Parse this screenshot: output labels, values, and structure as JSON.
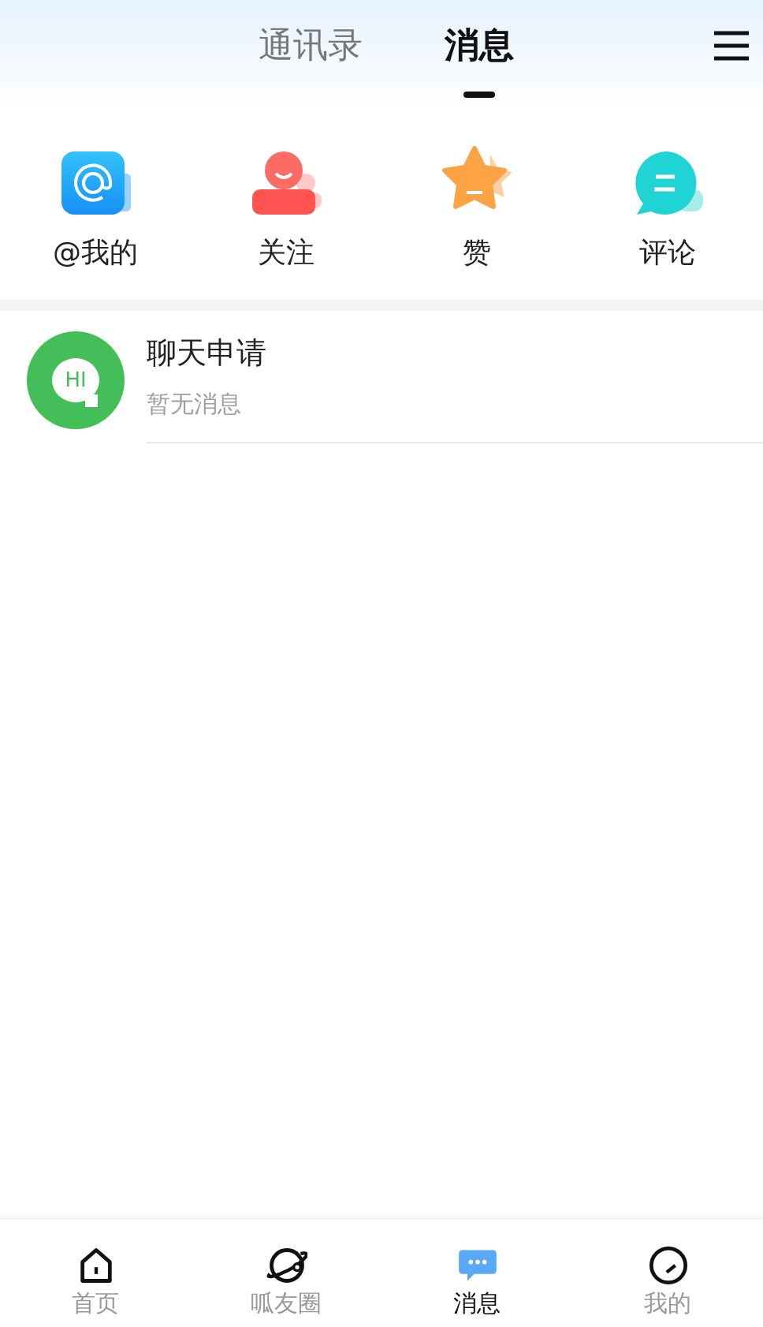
{
  "header": {
    "tabs": [
      {
        "label": "通讯录",
        "selected": false
      },
      {
        "label": "消息",
        "selected": true
      }
    ]
  },
  "shortcuts": [
    {
      "kind": "at",
      "label": "@我的"
    },
    {
      "kind": "follow",
      "label": "关注"
    },
    {
      "kind": "like",
      "label": "赞"
    },
    {
      "kind": "comment",
      "label": "评论"
    }
  ],
  "conversations": [
    {
      "avatar_text": "HI",
      "title": "聊天申请",
      "preview": "暂无消息"
    }
  ],
  "bottom_nav": [
    {
      "kind": "home",
      "label": "首页",
      "selected": false
    },
    {
      "kind": "planet",
      "label": "呱友圈",
      "selected": false
    },
    {
      "kind": "message",
      "label": "消息",
      "selected": true
    },
    {
      "kind": "profile",
      "label": "我的",
      "selected": false
    }
  ]
}
